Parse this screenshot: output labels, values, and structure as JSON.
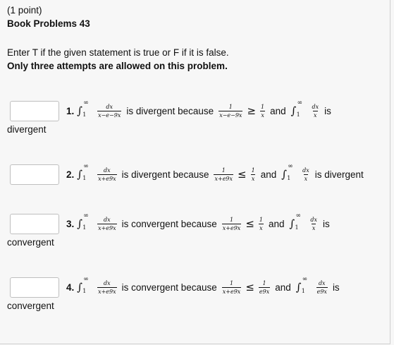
{
  "header": {
    "points": "(1 point)",
    "title": "Book Problems 43"
  },
  "instructions": {
    "line1": "Enter T if the given statement is true or F if it is false.",
    "line2": "Only three attempts are allowed on this problem."
  },
  "math": {
    "integral": "∫",
    "inf": "∞",
    "one": "1",
    "dx": "dx",
    "x": "x",
    "x_minus_e9x": "x−e−9x",
    "x_plus_e9x": "x+e9x",
    "e9x": "e9x",
    "ge": "≥",
    "le": "≤"
  },
  "problems": [
    {
      "number": "1.",
      "mid": "is divergent because",
      "and": "and",
      "tail": "is",
      "wrap": "divergent"
    },
    {
      "number": "2.",
      "mid": "is divergent because",
      "and": "and",
      "tail": "is divergent",
      "wrap": ""
    },
    {
      "number": "3.",
      "mid": "is convergent because",
      "and": "and",
      "tail": "is",
      "wrap": "convergent"
    },
    {
      "number": "4.",
      "mid": "is convergent because",
      "and": "and",
      "tail": "is",
      "wrap": "convergent"
    }
  ],
  "answers": [
    "",
    "",
    "",
    ""
  ]
}
